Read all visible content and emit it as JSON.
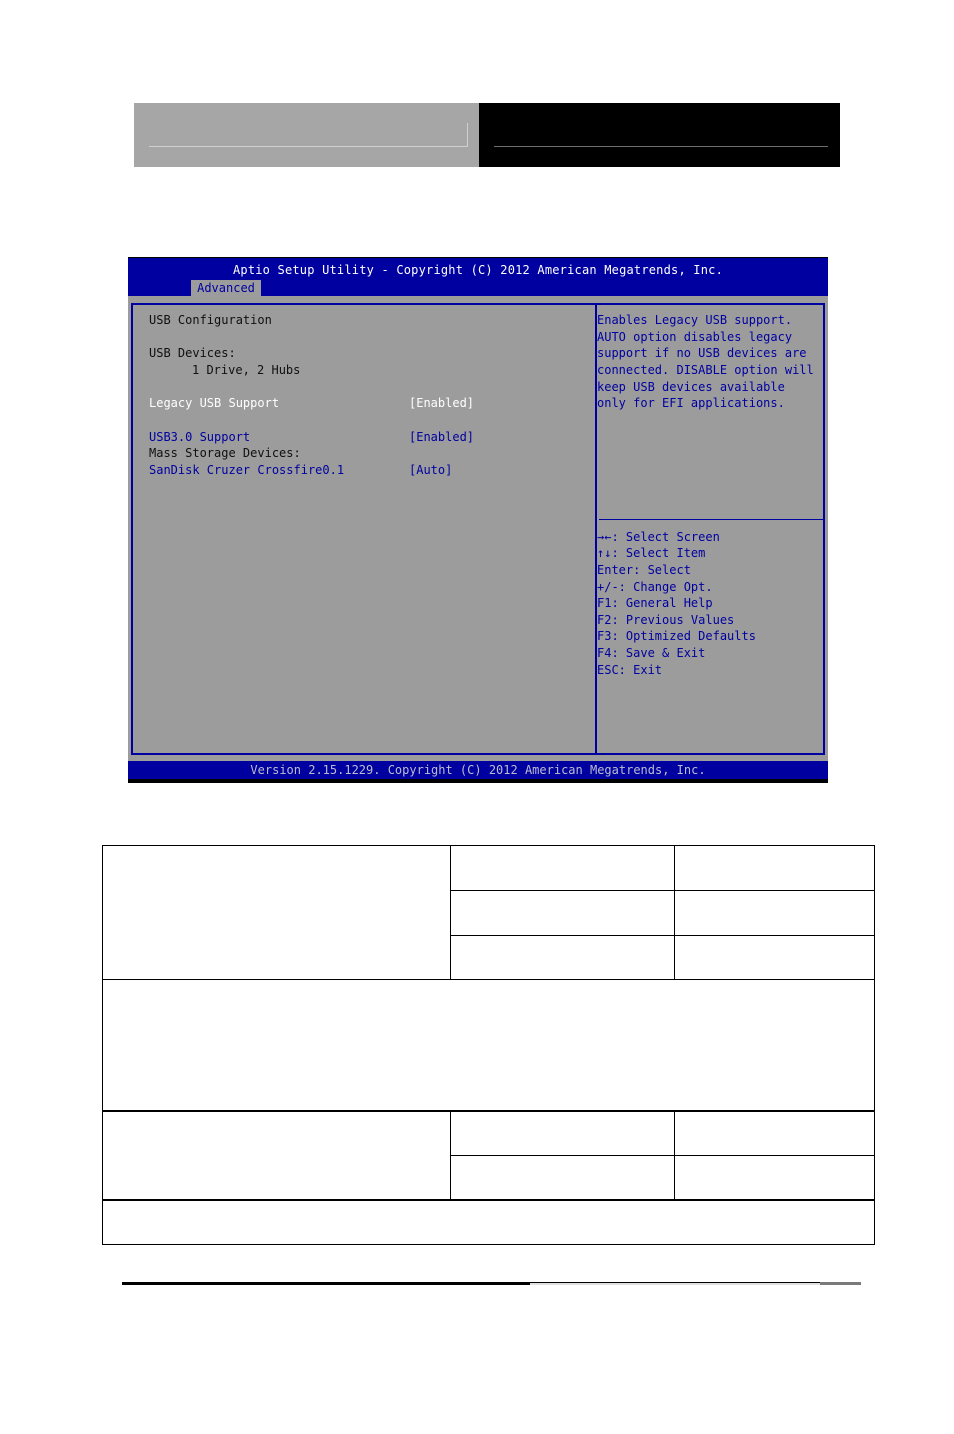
{
  "bios": {
    "title": "Aptio Setup Utility - Copyright (C) 2012 American Megatrends, Inc.",
    "active_tab": "Advanced",
    "footer": "Version 2.15.1229. Copyright (C) 2012 American Megatrends, Inc.",
    "colors": {
      "frame_blue": "#0000a0",
      "panel_gray": "#9c9c9c",
      "selected_text": "#ffffff",
      "option_text": "#0000a0",
      "static_text": "#101010"
    },
    "settings": {
      "section_title": "USB Configuration",
      "usb_devices_label": "USB Devices:",
      "usb_devices_value": "1 Drive, 2 Hubs",
      "items": [
        {
          "label": "Legacy USB Support",
          "value": "[Enabled]",
          "selected": true
        },
        {
          "label": "USB3.0 Support",
          "value": "[Enabled]",
          "selected": false
        }
      ],
      "mass_storage_label": "Mass Storage Devices:",
      "mass_storage_items": [
        {
          "label": "SanDisk Cruzer Crossfire0.1",
          "value": "[Auto]",
          "selected": false
        }
      ]
    },
    "help_text": [
      "Enables Legacy USB support.",
      "AUTO option disables legacy",
      "support if no USB devices are",
      "connected. DISABLE option will",
      "keep USB devices available",
      "only for EFI applications."
    ],
    "key_help": [
      {
        "icon": "left-right-arrows-icon",
        "glyph": "→←",
        "text": ": Select Screen"
      },
      {
        "icon": "up-down-arrows-icon",
        "glyph": "↑↓",
        "text": ": Select Item"
      },
      {
        "icon": "",
        "glyph": "",
        "text": "Enter: Select"
      },
      {
        "icon": "",
        "glyph": "",
        "text": "+/-: Change Opt."
      },
      {
        "icon": "",
        "glyph": "",
        "text": "F1: General Help"
      },
      {
        "icon": "",
        "glyph": "",
        "text": "F2: Previous Values"
      },
      {
        "icon": "",
        "glyph": "",
        "text": "F3: Optimized Defaults"
      },
      {
        "icon": "",
        "glyph": "",
        "text": "F4: Save & Exit"
      },
      {
        "icon": "",
        "glyph": "",
        "text": "ESC: Exit"
      }
    ]
  },
  "options_table": {
    "rows": []
  }
}
